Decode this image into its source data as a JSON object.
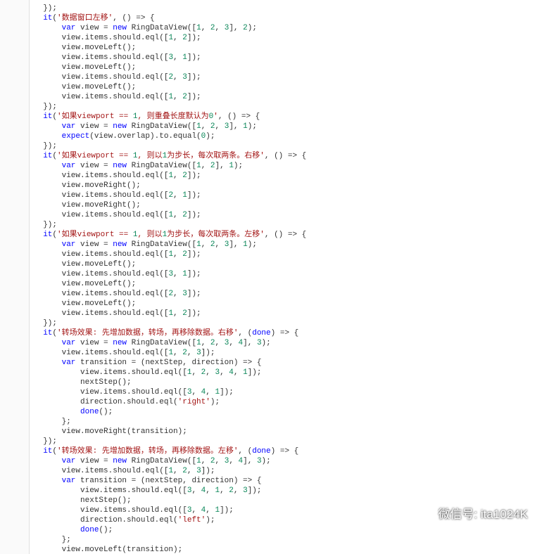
{
  "code": {
    "lines": [
      "  });",
      "  it('数据窗口左移', () => {",
      "      var view = new RingDataView([1, 2, 3], 2);",
      "      view.items.should.eql([1, 2]);",
      "      view.moveLeft();",
      "      view.items.should.eql([3, 1]);",
      "      view.moveLeft();",
      "      view.items.should.eql([2, 3]);",
      "      view.moveLeft();",
      "      view.items.should.eql([1, 2]);",
      "  });",
      "  it('如果viewport == 1, 则重叠长度默认为0', () => {",
      "      var view = new RingDataView([1, 2, 3], 1);",
      "      expect(view.overlap).to.equal(0);",
      "  });",
      "  it('如果viewport == 1, 则以1为步长，每次取两条。右移', () => {",
      "      var view = new RingDataView([1, 2], 1);",
      "      view.items.should.eql([1, 2]);",
      "      view.moveRight();",
      "      view.items.should.eql([2, 1]);",
      "      view.moveRight();",
      "      view.items.should.eql([1, 2]);",
      "  });",
      "  it('如果viewport == 1, 则以1为步长，每次取两条。左移', () => {",
      "      var view = new RingDataView([1, 2, 3], 1);",
      "      view.items.should.eql([1, 2]);",
      "      view.moveLeft();",
      "      view.items.should.eql([3, 1]);",
      "      view.moveLeft();",
      "      view.items.should.eql([2, 3]);",
      "      view.moveLeft();",
      "      view.items.should.eql([1, 2]);",
      "  });",
      "  it('转场效果: 先增加数据，转场，再移除数据。右移', (done) => {",
      "      var view = new RingDataView([1, 2, 3, 4], 3);",
      "      view.items.should.eql([1, 2, 3]);",
      "      var transition = (nextStep, direction) => {",
      "          view.items.should.eql([1, 2, 3, 4, 1]);",
      "          nextStep();",
      "          view.items.should.eql([3, 4, 1]);",
      "          direction.should.eql('right');",
      "          done();",
      "      };",
      "      view.moveRight(transition);",
      "  });",
      "  it('转场效果: 先增加数据，转场，再移除数据。左移', (done) => {",
      "      var view = new RingDataView([1, 2, 3, 4], 3);",
      "      view.items.should.eql([1, 2, 3]);",
      "      var transition = (nextStep, direction) => {",
      "          view.items.should.eql([3, 4, 1, 2, 3]);",
      "          nextStep();",
      "          view.items.should.eql([3, 4, 1]);",
      "          direction.should.eql('left');",
      "          done();",
      "      };",
      "      view.moveLeft(transition);",
      "  });"
    ]
  },
  "watermark": {
    "label": "微信号: ita1024K"
  }
}
